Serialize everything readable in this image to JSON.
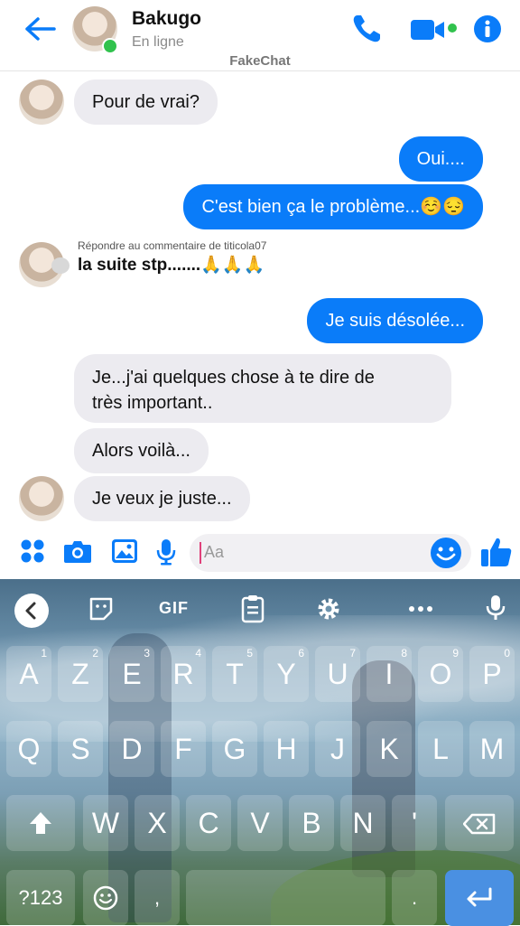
{
  "header": {
    "contact_name": "Bakugo",
    "status": "En ligne",
    "watermark": "FakeChat"
  },
  "messages": [
    {
      "dir": "in",
      "text": "Pour de vrai?"
    },
    {
      "dir": "out",
      "text": "Oui...."
    },
    {
      "dir": "out",
      "text": "C'est bien ça le problème...☺️😔"
    },
    {
      "dir": "out",
      "text": "Je suis désolée..."
    },
    {
      "dir": "in",
      "text": "Je...j'ai quelques chose à te dire de"
    },
    {
      "dir": "in",
      "text": "très important.."
    },
    {
      "dir": "in",
      "text": "Alors voilà..."
    },
    {
      "dir": "in",
      "text": "Je veux je juste..."
    }
  ],
  "reply": {
    "label": "Répondre au commentaire de titicola07",
    "text": "la suite stp.......🙏🙏🙏"
  },
  "composer": {
    "placeholder": "Aa"
  },
  "keyboard": {
    "toolbar": [
      "chevron-left-icon",
      "sticker-icon",
      "GIF",
      "clipboard-icon",
      "gear-icon",
      "more-icon",
      "mic-icon"
    ],
    "gif_label": "GIF",
    "row1": [
      "A",
      "Z",
      "E",
      "R",
      "T",
      "Y",
      "U",
      "I",
      "O",
      "P"
    ],
    "row1_nums": [
      "1",
      "2",
      "3",
      "4",
      "5",
      "6",
      "7",
      "8",
      "9",
      "0"
    ],
    "row2": [
      "Q",
      "S",
      "D",
      "F",
      "G",
      "H",
      "J",
      "K",
      "L",
      "M"
    ],
    "row3": [
      "W",
      "X",
      "C",
      "V",
      "B",
      "N",
      "'"
    ],
    "symbols_label": "?123",
    "comma": ",",
    "period": "."
  },
  "colors": {
    "accent": "#0a7cf9",
    "online": "#31c24d",
    "incoming_bubble": "#ecebf0"
  }
}
